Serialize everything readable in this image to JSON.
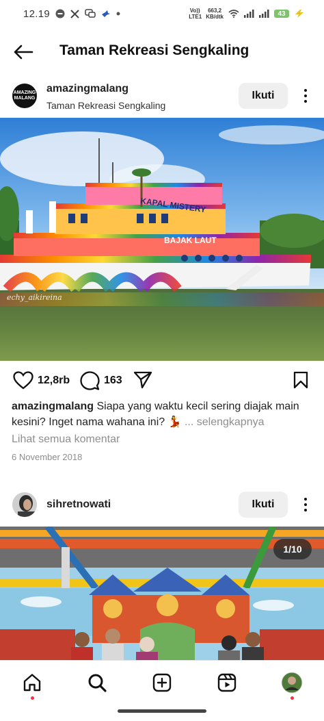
{
  "status_bar": {
    "time": "12.19",
    "network_type": "Vo)) LTE1",
    "data_speed_value": "663,2",
    "data_speed_unit": "KB/dtk",
    "battery_level": "43"
  },
  "app_bar": {
    "title": "Taman Rekreasi Sengkaling"
  },
  "post1": {
    "username": "amazingmalang",
    "location": "Taman Rekreasi Sengkaling",
    "follow_label": "Ikuti",
    "avatar_text_line1": "AMAZING",
    "avatar_text_line2": "MALANG",
    "image_watermark": "echy_aikireina",
    "boat_sign_top": "KAPAL MISTERY",
    "boat_sign_bottom": "BAJAK LAUT",
    "likes": "12,8rb",
    "comments": "163",
    "caption_username": "amazingmalang",
    "caption_text": "Siapa yang waktu kecil sering diajak main kesini? Inget nama wahana ini? 💃",
    "caption_more": "... selengkapnya",
    "view_comments": "Lihat semua komentar",
    "date": "6 November 2018"
  },
  "post2": {
    "username": "sihretnowati",
    "follow_label": "Ikuti",
    "image_counter": "1/10"
  },
  "bottom_nav": {
    "items": [
      "home-icon",
      "search-icon",
      "create-icon",
      "reels-icon",
      "profile-avatar"
    ]
  },
  "colors": {
    "follow_button_bg": "#efefef",
    "secondary_text": "#8e8e8e",
    "notification_dot": "#ff3040"
  }
}
